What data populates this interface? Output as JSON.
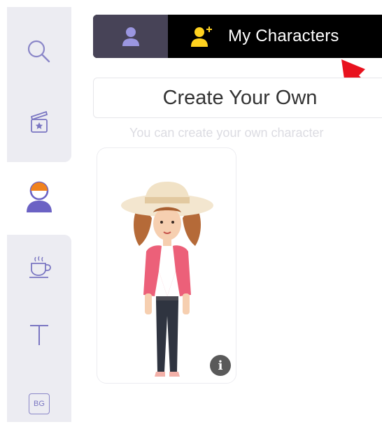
{
  "sidebar": {
    "items": [
      {
        "icon": "search-icon"
      },
      {
        "icon": "scene-icon"
      },
      {
        "icon": "character-icon",
        "active": true
      },
      {
        "icon": "coffee-cup-icon"
      },
      {
        "icon": "text-icon",
        "label": "T"
      },
      {
        "icon": "background-icon",
        "label": "BG"
      }
    ]
  },
  "tabs": {
    "default_tab_icon": "person-icon",
    "my_characters_icon": "person-add-icon",
    "my_characters_label": "My Characters"
  },
  "create": {
    "button_label": "Create Your Own",
    "hint": "You can create your own character"
  },
  "characters": [
    {
      "name": "",
      "info_icon": "info-icon",
      "info_label": "i"
    }
  ],
  "colors": {
    "sidebar_bg": "#ececf2",
    "icon_purple": "#7a76c2",
    "tab_active_bg": "#474357",
    "tab_bar_bg": "#000000",
    "accent_yellow": "#ffd21f",
    "pointer_red": "#e8121e"
  }
}
